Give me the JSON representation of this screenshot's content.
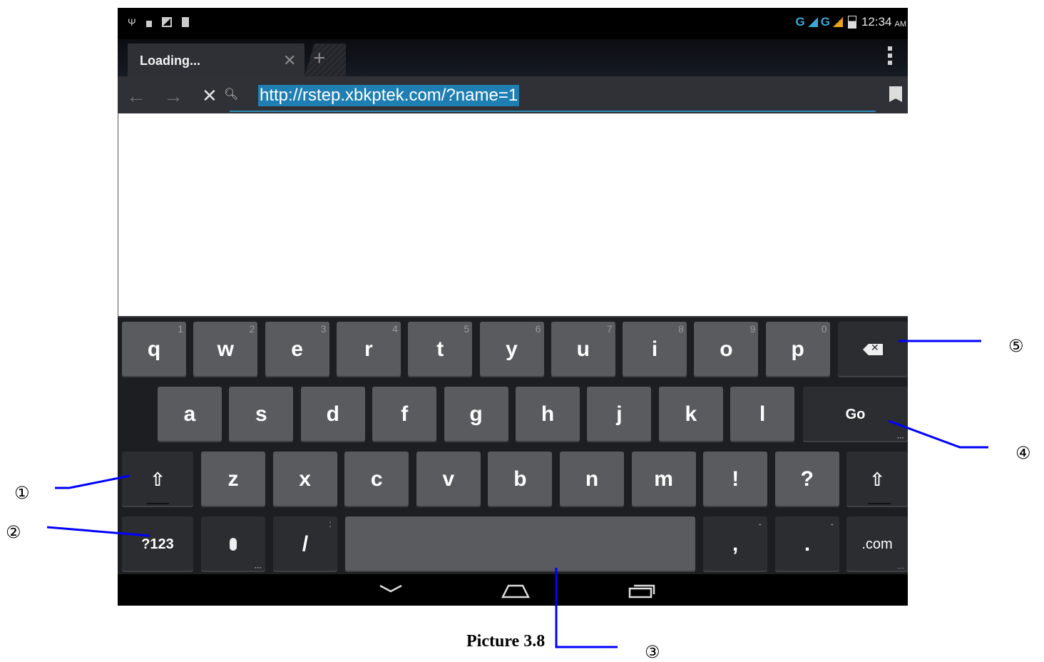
{
  "status_bar": {
    "signal_text": "G",
    "signal_text_2": "G",
    "time": "12:34",
    "ampm": "AM"
  },
  "tab": {
    "title": "Loading...",
    "close_icon": "close-icon",
    "new_tab_icon": "plus-icon"
  },
  "url_bar": {
    "url": "http://rstep.xbkptek.com/?name=1"
  },
  "keyboard": {
    "row1": [
      {
        "label": "q",
        "hint": "1"
      },
      {
        "label": "w",
        "hint": "2"
      },
      {
        "label": "e",
        "hint": "3"
      },
      {
        "label": "r",
        "hint": "4"
      },
      {
        "label": "t",
        "hint": "5"
      },
      {
        "label": "y",
        "hint": "6"
      },
      {
        "label": "u",
        "hint": "7"
      },
      {
        "label": "i",
        "hint": "8"
      },
      {
        "label": "o",
        "hint": "9"
      },
      {
        "label": "p",
        "hint": "0"
      }
    ],
    "row2": [
      "a",
      "s",
      "d",
      "f",
      "g",
      "h",
      "j",
      "k",
      "l"
    ],
    "row3": [
      "z",
      "x",
      "c",
      "v",
      "b",
      "n",
      "m",
      "!",
      "?"
    ],
    "go_label": "Go",
    "symbols_label": "?123",
    "slash_label": "/",
    "comma_label": ",",
    "period_label": ".",
    "com_label": ".com"
  },
  "annotations": {
    "c1": "①",
    "c2": "②",
    "c3": "③",
    "c4": "④",
    "c5": "⑤",
    "caption": "Picture 3.8"
  },
  "colors": {
    "accent": "#1f7fb2",
    "callout_line": "#0000ff",
    "key": "#5a5b5e",
    "key_dark": "#2c2d31"
  }
}
